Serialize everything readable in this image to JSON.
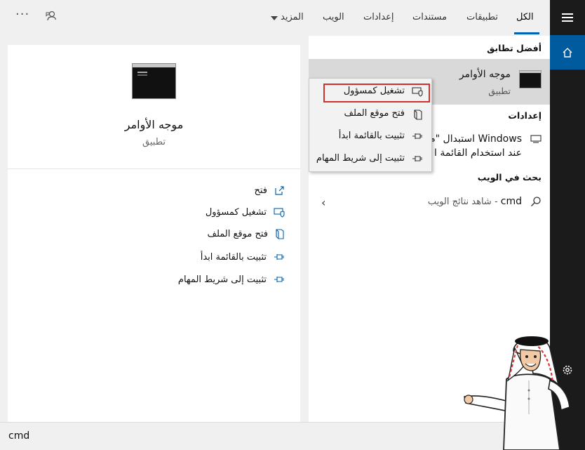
{
  "topbar": {
    "tabs": [
      "الكل",
      "تطبيقات",
      "مستندات",
      "إعدادات",
      "الويب",
      "المزيد"
    ],
    "more_dots": "···"
  },
  "results": {
    "best_match_heading": "أفضل تطابق",
    "best_match": {
      "name": "موجه الأوامر",
      "kind": "تطبيق"
    },
    "settings_heading": "إعدادات",
    "settings_line1": "Windows استبدال \"م",
    "settings_line2": "عند استخدام القائمة ا",
    "web_heading": "بحث في الويب",
    "web_query": "cmd",
    "web_suffix": " - شاهد نتائج الويب",
    "chevron": "‹"
  },
  "context_menu": {
    "items": [
      "تشغيل كمسؤول",
      "فتح موقع الملف",
      "تثبيت بالقائمة ابدأ",
      "تثبيت إلى شريط المهام"
    ]
  },
  "preview": {
    "title": "موجه الأوامر",
    "subtitle": "تطبيق",
    "actions": [
      "فتح",
      "تشغيل كمسؤول",
      "فتح موقع الملف",
      "تثبيت بالقائمة ابدأ",
      "تثبيت إلى شريط المهام"
    ]
  },
  "search": {
    "value": "cmd"
  },
  "colors": {
    "accent": "#0063b1",
    "sidebar": "#1b1b1b",
    "home_highlight": "#005a9e",
    "selection_outline": "#d32f2f"
  },
  "icons": {
    "menu": "hamburger-icon",
    "home": "home-icon",
    "settings": "gear-icon",
    "feedback": "feedback-icon",
    "search": "search-icon",
    "open": "open-icon",
    "admin": "shield-icon",
    "file_location": "folder-icon",
    "pin": "pin-icon",
    "monitor": "monitor-icon"
  }
}
